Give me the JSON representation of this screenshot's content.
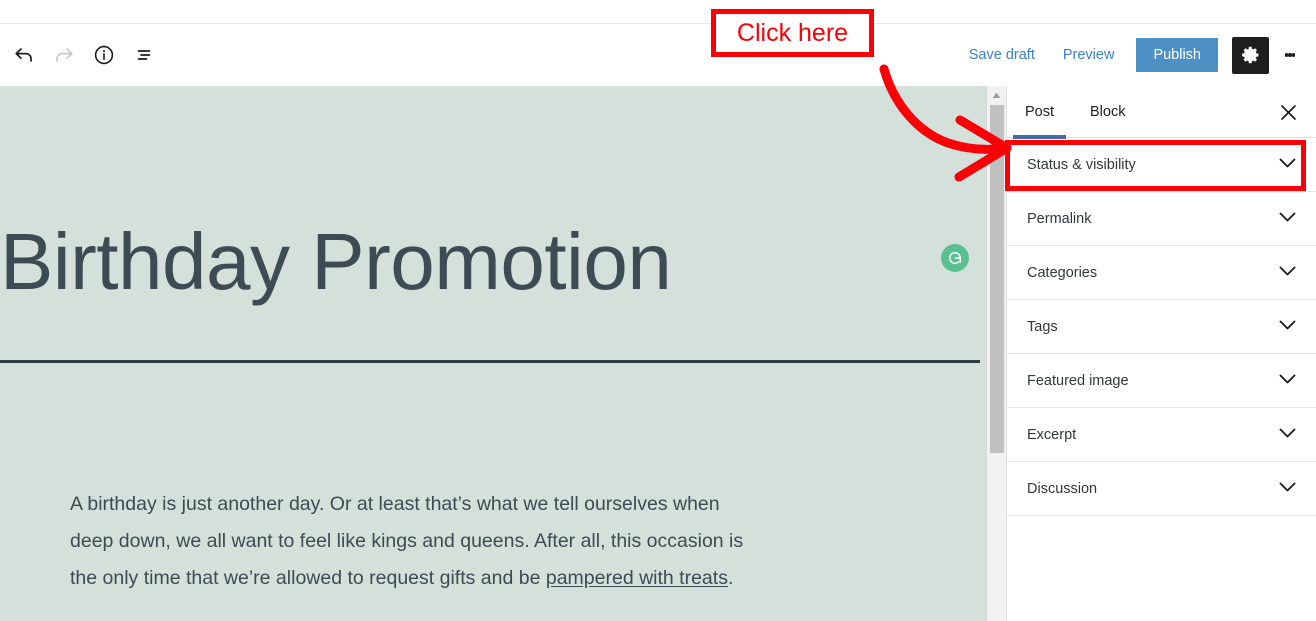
{
  "header": {
    "undo_icon": "undo-arrow-icon",
    "redo_icon": "redo-arrow-icon",
    "info_icon": "info-circle-icon",
    "list_view_icon": "list-view-icon",
    "save_draft_label": "Save draft",
    "preview_label": "Preview",
    "publish_label": "Publish",
    "settings_icon": "gear-icon",
    "more_options_icon": "kebab-menu-icon",
    "link_color": "#3882c4",
    "publish_bg": "#4d90c4",
    "settings_bg": "#1e1e1e"
  },
  "editor": {
    "background_color": "#d3e1da",
    "title": "Birthday Promotion",
    "title_color": "#3d4b54",
    "grammarly_icon": "grammarly-circle-icon",
    "grammarly_color": "#5cbf92",
    "separator": "horizontal-rule",
    "body_part1": "A birthday is just another day. Or at least that’s what we tell ourselves when deep down, we all want to feel like kings and queens. After all, this occasion is the only time that we’re allowed to request gifts and be ",
    "body_link": "pampered with treats",
    "body_part2": "."
  },
  "scrollbar": {
    "up_arrow_icon": "scroll-up-arrow-icon",
    "thumb": "scrollbar-thumb"
  },
  "sidebar": {
    "tabs": [
      {
        "label": "Post",
        "active": true
      },
      {
        "label": "Block",
        "active": false
      }
    ],
    "close_icon": "close-icon",
    "active_tab_color": "#3e6ea8",
    "panels": [
      {
        "label": "Status & visibility",
        "icon": "chevron-down-icon",
        "highlighted": true
      },
      {
        "label": "Permalink",
        "icon": "chevron-down-icon",
        "highlighted": false
      },
      {
        "label": "Categories",
        "icon": "chevron-down-icon",
        "highlighted": false
      },
      {
        "label": "Tags",
        "icon": "chevron-down-icon",
        "highlighted": false
      },
      {
        "label": "Featured image",
        "icon": "chevron-down-icon",
        "highlighted": false
      },
      {
        "label": "Excerpt",
        "icon": "chevron-down-icon",
        "highlighted": false
      },
      {
        "label": "Discussion",
        "icon": "chevron-down-icon",
        "highlighted": false
      }
    ]
  },
  "annotation": {
    "callout_text": "Click here",
    "color": "#fb0007",
    "arrow_icon": "curved-arrow-icon",
    "target_panel": "Status & visibility"
  }
}
